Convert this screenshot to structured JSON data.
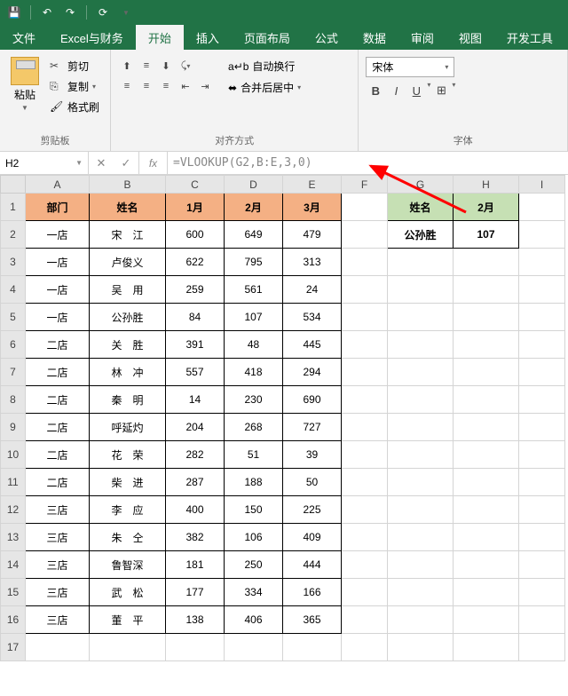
{
  "titlebar": {
    "icons": [
      "save",
      "undo",
      "redo",
      "refresh"
    ]
  },
  "tabs": {
    "items": [
      "文件",
      "Excel与财务",
      "开始",
      "插入",
      "页面布局",
      "公式",
      "数据",
      "审阅",
      "视图",
      "开发工具"
    ],
    "active": 2
  },
  "ribbon": {
    "clipboard": {
      "label": "剪贴板",
      "paste": "粘贴",
      "cut": "剪切",
      "copy": "复制",
      "format_painter": "格式刷"
    },
    "alignment": {
      "label": "对齐方式",
      "wrap_text": "自动换行",
      "merge_center": "合并后居中"
    },
    "font": {
      "label": "字体",
      "font_name": "宋体"
    }
  },
  "namebox": "H2",
  "formula": "=VLOOKUP(G2,B:E,3,0)",
  "columns": [
    "A",
    "B",
    "C",
    "D",
    "E",
    "F",
    "G",
    "H",
    "I"
  ],
  "rows": [
    1,
    2,
    3,
    4,
    5,
    6,
    7,
    8,
    9,
    10,
    11,
    12,
    13,
    14,
    15,
    16,
    17
  ],
  "main_table": {
    "headers": [
      "部门",
      "姓名",
      "1月",
      "2月",
      "3月"
    ],
    "data": [
      [
        "一店",
        "宋　江",
        "600",
        "649",
        "479"
      ],
      [
        "一店",
        "卢俊义",
        "622",
        "795",
        "313"
      ],
      [
        "一店",
        "吴　用",
        "259",
        "561",
        "24"
      ],
      [
        "一店",
        "公孙胜",
        "84",
        "107",
        "534"
      ],
      [
        "二店",
        "关　胜",
        "391",
        "48",
        "445"
      ],
      [
        "二店",
        "林　冲",
        "557",
        "418",
        "294"
      ],
      [
        "二店",
        "秦　明",
        "14",
        "230",
        "690"
      ],
      [
        "二店",
        "呼延灼",
        "204",
        "268",
        "727"
      ],
      [
        "二店",
        "花　荣",
        "282",
        "51",
        "39"
      ],
      [
        "二店",
        "柴　进",
        "287",
        "188",
        "50"
      ],
      [
        "三店",
        "李　应",
        "400",
        "150",
        "225"
      ],
      [
        "三店",
        "朱　仝",
        "382",
        "106",
        "409"
      ],
      [
        "三店",
        "鲁智深",
        "181",
        "250",
        "444"
      ],
      [
        "三店",
        "武　松",
        "177",
        "334",
        "166"
      ],
      [
        "三店",
        "董　平",
        "138",
        "406",
        "365"
      ]
    ]
  },
  "lookup_table": {
    "headers": [
      "姓名",
      "2月"
    ],
    "name": "公孙胜",
    "value": "107"
  },
  "chart_data": {
    "type": "table",
    "title": "VLOOKUP example: monthly values by store/name",
    "columns": [
      "部门",
      "姓名",
      "1月",
      "2月",
      "3月"
    ],
    "rows": [
      [
        "一店",
        "宋江",
        600,
        649,
        479
      ],
      [
        "一店",
        "卢俊义",
        622,
        795,
        313
      ],
      [
        "一店",
        "吴用",
        259,
        561,
        24
      ],
      [
        "一店",
        "公孙胜",
        84,
        107,
        534
      ],
      [
        "二店",
        "关胜",
        391,
        48,
        445
      ],
      [
        "二店",
        "林冲",
        557,
        418,
        294
      ],
      [
        "二店",
        "秦明",
        14,
        230,
        690
      ],
      [
        "二店",
        "呼延灼",
        204,
        268,
        727
      ],
      [
        "二店",
        "花荣",
        282,
        51,
        39
      ],
      [
        "二店",
        "柴进",
        287,
        188,
        50
      ],
      [
        "三店",
        "李应",
        400,
        150,
        225
      ],
      [
        "三店",
        "朱仝",
        382,
        106,
        409
      ],
      [
        "三店",
        "鲁智深",
        181,
        250,
        444
      ],
      [
        "三店",
        "武松",
        177,
        334,
        166
      ],
      [
        "三店",
        "董平",
        138,
        406,
        365
      ]
    ],
    "lookup": {
      "formula": "=VLOOKUP(G2,B:E,3,0)",
      "input": "公孙胜",
      "result": 107
    }
  }
}
